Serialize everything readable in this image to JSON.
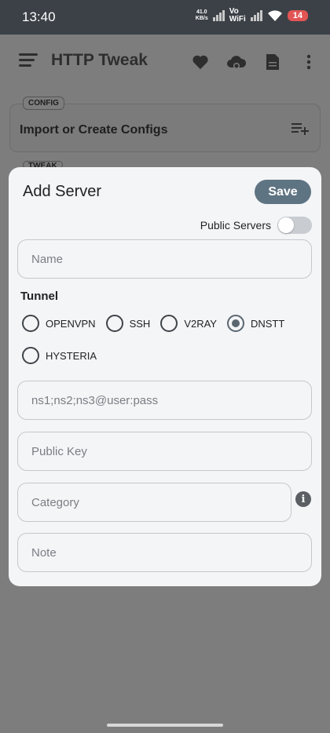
{
  "status_bar": {
    "time": "13:40",
    "net_speed_value": "41.0",
    "net_speed_unit": "KB/s",
    "vowifi_top": "Vo",
    "vowifi_bottom": "WiFi",
    "battery": "14"
  },
  "app": {
    "title": "HTTP Tweak",
    "config_chip": "CONFIG",
    "config_text": "Import or Create Configs",
    "tweak_chip": "TWEAK"
  },
  "dialog": {
    "title": "Add Server",
    "save_label": "Save",
    "public_servers_label": "Public Servers",
    "public_servers_on": false,
    "name_placeholder": "Name",
    "tunnel_label": "Tunnel",
    "tunnel_options": [
      "OPENVPN",
      "SSH",
      "V2RAY",
      "DNSTT",
      "HYSTERIA"
    ],
    "tunnel_selected": "DNSTT",
    "server_placeholder": "ns1;ns2;ns3@user:pass",
    "public_key_placeholder": "Public Key",
    "category_placeholder": "Category",
    "note_placeholder": "Note"
  },
  "colors": {
    "accent": "#5f7482",
    "status_bar": "#3b4147",
    "scrim": "#7d7d7d",
    "battery": "#e25555"
  },
  "icons": [
    "menu-icon",
    "heart-icon",
    "cloud-icon",
    "document-icon",
    "more-vert-icon",
    "playlist-add-icon",
    "info-icon"
  ]
}
